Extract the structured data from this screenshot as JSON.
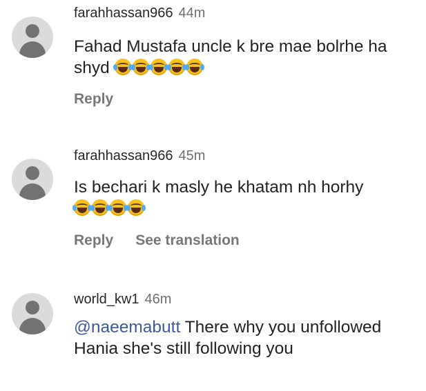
{
  "comments": [
    {
      "username": "farahhassan966",
      "time": "44m",
      "text": "Fahad Mustafa uncle k bre mae bolrhe ha shyd",
      "emoji_name": "face-with-tears-of-joy-icon",
      "emoji_count": 5,
      "actions": [
        "Reply"
      ]
    },
    {
      "username": "farahhassan966",
      "time": "45m",
      "text": "Is bechari k masly he khatam nh horhy",
      "emoji_name": "face-with-tears-of-joy-icon",
      "emoji_count": 4,
      "actions": [
        "Reply",
        "See translation"
      ]
    },
    {
      "username": "world_kw1",
      "time": "46m",
      "mention": "@naeemabutt",
      "text": " There why you unfollowed Hania she's still following you",
      "actions": []
    }
  ],
  "colors": {
    "mention": "#3c5a99",
    "avatar_bg": "#dbdbdb",
    "avatar_fg": "#727272",
    "action_text": "#777777"
  }
}
